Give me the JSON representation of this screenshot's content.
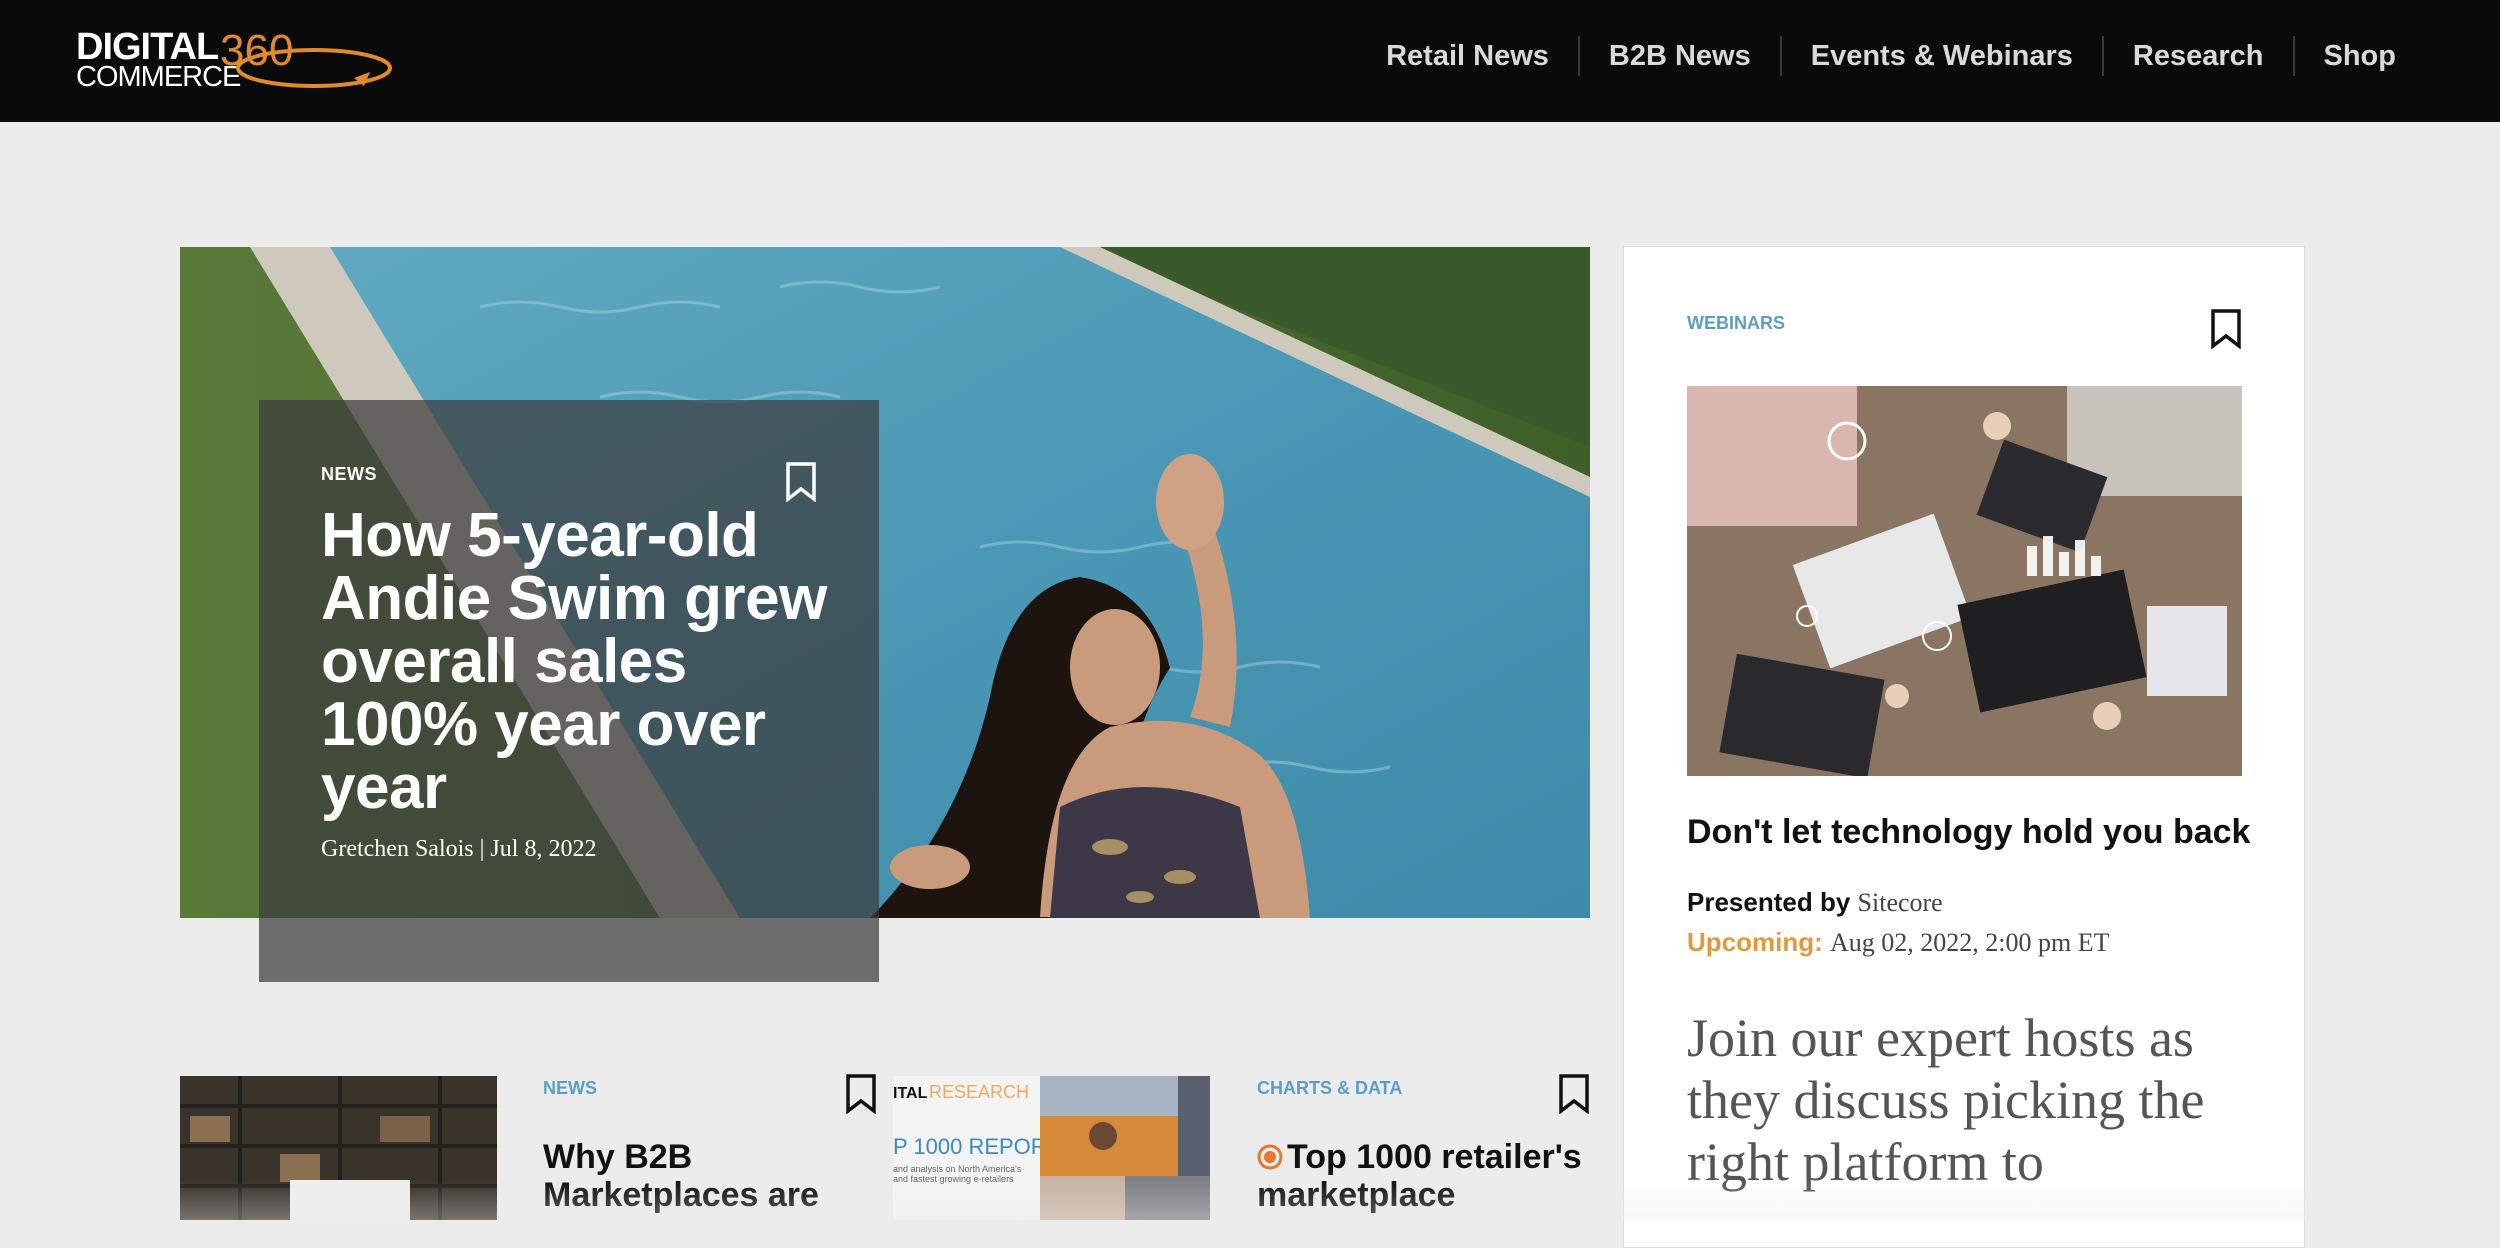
{
  "header": {
    "logo": {
      "line1": "DIGITAL",
      "line2": "COMMERCE",
      "number": "360"
    },
    "nav": [
      {
        "label": "Retail News"
      },
      {
        "label": "B2B News"
      },
      {
        "label": "Events & Webinars"
      },
      {
        "label": "Research"
      },
      {
        "label": "Shop"
      }
    ]
  },
  "hero": {
    "category": "NEWS",
    "title": "How 5-year-old Andie Swim grew overall sales 100% year over year",
    "byline": "Gretchen Salois | Jul 8, 2022"
  },
  "sidebar": {
    "category": "WEBINARS",
    "title": "Don't let technology hold you back",
    "presented_label": "Presented by",
    "presenter": "Sitecore",
    "upcoming_label": "Upcoming:",
    "date": "Aug 02, 2022, 2:00 pm ET",
    "description": "Join our expert hosts as they discuss picking the right platform to"
  },
  "articles": [
    {
      "category": "NEWS",
      "title_line1": "Why B2B",
      "title_line2": "Marketplaces are"
    },
    {
      "thumb_text1": "ITAL",
      "thumb_text2": "RESEARCH",
      "thumb_text3": "P 1000 REPORT",
      "thumb_text4": "and analysis on North America's",
      "thumb_text5": "and fastest growing e-retailers"
    },
    {
      "category": "CHARTS & DATA",
      "title_line1": "Top 1000 retailer's",
      "title_line2": "marketplace"
    }
  ],
  "colors": {
    "accent_blue": "#5a9ec7",
    "accent_orange": "#e09a3c",
    "header_bg": "#0a0a0a",
    "page_bg": "#ececec"
  }
}
